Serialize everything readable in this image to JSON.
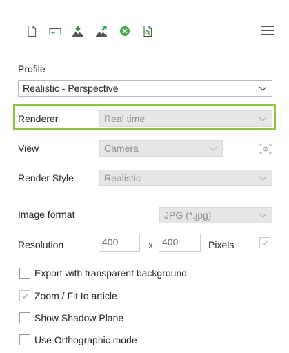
{
  "toolbar": {
    "icons": [
      "new-document-icon",
      "rename-icon",
      "import-icon",
      "export-icon",
      "delete-icon",
      "preview-icon"
    ],
    "menu_icon": "hamburger-menu-icon"
  },
  "profile": {
    "label": "Profile",
    "value": "Realistic - Perspective"
  },
  "renderer": {
    "label": "Renderer",
    "value": "Real time"
  },
  "view": {
    "label": "View",
    "value": "Camera"
  },
  "render_style": {
    "label": "Render Style",
    "value": "Realistic"
  },
  "image_format": {
    "label": "Image format",
    "value": "JPG (*.jpg)"
  },
  "resolution": {
    "label": "Resolution",
    "width": "400",
    "separator": "x",
    "height": "400",
    "unit": "Pixels",
    "locked": true
  },
  "options": [
    {
      "label": "Export with transparent background",
      "checked": false
    },
    {
      "label": "Zoom / Fit to article",
      "checked": true
    },
    {
      "label": "Show Shadow Plane",
      "checked": false
    },
    {
      "label": "Use Orthographic mode",
      "checked": false
    }
  ],
  "colors": {
    "highlight": "#8cc63f",
    "icon_green": "#2e9e3a",
    "icon_delete": "#3fae49"
  }
}
